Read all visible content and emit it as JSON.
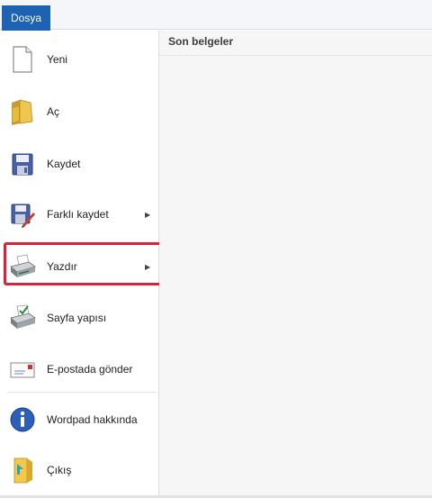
{
  "ribbon": {
    "file_tab": "Dosya"
  },
  "menu": {
    "items": [
      {
        "label": "Yeni",
        "icon": "new-document-icon"
      },
      {
        "label": "Aç",
        "icon": "open-folder-icon"
      },
      {
        "label": "Kaydet",
        "icon": "save-floppy-icon"
      },
      {
        "label": "Farklı kaydet",
        "icon": "save-as-icon",
        "submenu": true
      },
      {
        "label": "Yazdır",
        "icon": "printer-icon",
        "submenu": true,
        "highlighted": true
      },
      {
        "label": "Sayfa yapısı",
        "icon": "page-setup-icon"
      },
      {
        "label": "E-postada gönder",
        "icon": "email-icon"
      },
      {
        "label": "Wordpad hakkında",
        "icon": "info-icon"
      },
      {
        "label": "Çıkış",
        "icon": "exit-icon"
      }
    ]
  },
  "recent": {
    "title": "Son belgeler"
  },
  "colors": {
    "accent": "#1e62b4",
    "highlight_border": "#d7243c"
  }
}
